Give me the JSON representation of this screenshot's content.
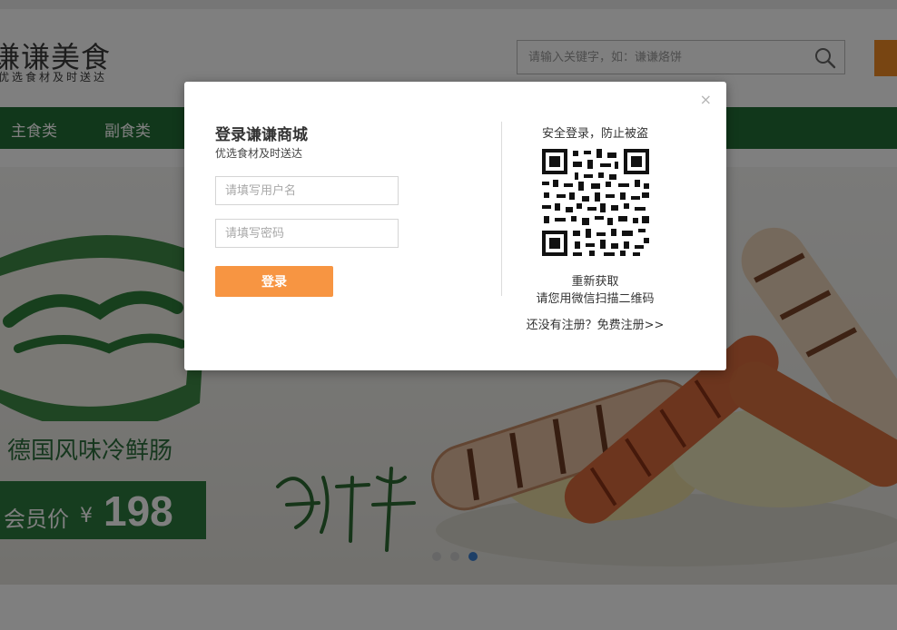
{
  "header": {
    "logo_title": "谦谦美食",
    "logo_subtitle": "优选食材及时送达",
    "search_placeholder": "请输入关键字，如：谦谦烙饼"
  },
  "nav": {
    "items": [
      "主食类",
      "副食类"
    ]
  },
  "banner": {
    "headline": "德国风味冷鲜肠",
    "member_price_label": "会员价",
    "currency": "¥",
    "price": "198",
    "slide_count": 3,
    "active_slide": 3
  },
  "login_modal": {
    "title": "登录谦谦商城",
    "subtitle": "优选食材及时送达",
    "username_placeholder": "请填写用户名",
    "password_placeholder": "请填写密码",
    "login_button": "登录",
    "close": "×",
    "qr_title": "安全登录，防止被盗",
    "qr_refresh": "重新获取",
    "qr_hint": "请您用微信扫描二维码",
    "register_link": "还没有注册？免费注册>>"
  },
  "colors": {
    "nav_green": "#236f37",
    "accent_orange": "#f79542",
    "active_dot": "#3b7fcf"
  }
}
